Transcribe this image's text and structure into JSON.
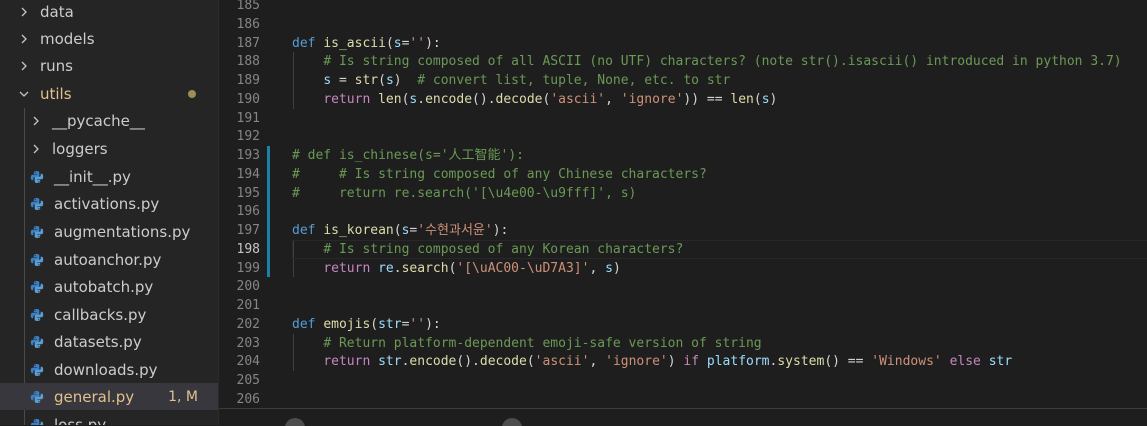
{
  "explorer": {
    "items": [
      {
        "label": "data",
        "kind": "folder",
        "expanded": false
      },
      {
        "label": "models",
        "kind": "folder",
        "expanded": false
      },
      {
        "label": "runs",
        "kind": "folder",
        "expanded": false
      },
      {
        "label": "utils",
        "kind": "folder",
        "expanded": true,
        "modified": true
      },
      {
        "label": "__pycache__",
        "kind": "folder",
        "expanded": false
      },
      {
        "label": "loggers",
        "kind": "folder",
        "expanded": false
      },
      {
        "label": "__init__.py",
        "kind": "file"
      },
      {
        "label": "activations.py",
        "kind": "file"
      },
      {
        "label": "augmentations.py",
        "kind": "file"
      },
      {
        "label": "autoanchor.py",
        "kind": "file"
      },
      {
        "label": "autobatch.py",
        "kind": "file"
      },
      {
        "label": "callbacks.py",
        "kind": "file"
      },
      {
        "label": "datasets.py",
        "kind": "file"
      },
      {
        "label": "downloads.py",
        "kind": "file"
      },
      {
        "label": "general.py",
        "kind": "file",
        "active": true,
        "badge": "1, M"
      },
      {
        "label": "loss.py",
        "kind": "file"
      }
    ]
  },
  "editor": {
    "current_line": "198",
    "lines": [
      {
        "n": "185",
        "tokens": []
      },
      {
        "n": "186",
        "tokens": []
      },
      {
        "n": "187",
        "tokens": [
          {
            "t": "def ",
            "c": "kw"
          },
          {
            "t": "is_ascii",
            "c": "fn"
          },
          {
            "t": "(",
            "c": "op"
          },
          {
            "t": "s",
            "c": "vr"
          },
          {
            "t": "=",
            "c": "op"
          },
          {
            "t": "''",
            "c": "str"
          },
          {
            "t": "):",
            "c": "op"
          }
        ]
      },
      {
        "n": "188",
        "tokens": [
          {
            "t": "    ",
            "c": "op"
          },
          {
            "t": "# Is string composed of all ASCII (no UTF) characters? (note str().isascii() introduced in python 3.7)",
            "c": "cm"
          }
        ]
      },
      {
        "n": "189",
        "tokens": [
          {
            "t": "    ",
            "c": "op"
          },
          {
            "t": "s",
            "c": "vr"
          },
          {
            "t": " = ",
            "c": "op"
          },
          {
            "t": "str",
            "c": "fn"
          },
          {
            "t": "(",
            "c": "op"
          },
          {
            "t": "s",
            "c": "vr"
          },
          {
            "t": ")  ",
            "c": "op"
          },
          {
            "t": "# convert list, tuple, None, etc. to str",
            "c": "cm"
          }
        ]
      },
      {
        "n": "190",
        "tokens": [
          {
            "t": "    ",
            "c": "op"
          },
          {
            "t": "return ",
            "c": "ctl"
          },
          {
            "t": "len",
            "c": "fn"
          },
          {
            "t": "(",
            "c": "op"
          },
          {
            "t": "s",
            "c": "vr"
          },
          {
            "t": ".",
            "c": "op"
          },
          {
            "t": "encode",
            "c": "fn"
          },
          {
            "t": "().",
            "c": "op"
          },
          {
            "t": "decode",
            "c": "fn"
          },
          {
            "t": "(",
            "c": "op"
          },
          {
            "t": "'ascii'",
            "c": "str"
          },
          {
            "t": ", ",
            "c": "op"
          },
          {
            "t": "'ignore'",
            "c": "str"
          },
          {
            "t": ")) == ",
            "c": "op"
          },
          {
            "t": "len",
            "c": "fn"
          },
          {
            "t": "(",
            "c": "op"
          },
          {
            "t": "s",
            "c": "vr"
          },
          {
            "t": ")",
            "c": "op"
          }
        ]
      },
      {
        "n": "191",
        "tokens": []
      },
      {
        "n": "192",
        "tokens": []
      },
      {
        "n": "193",
        "tokens": [
          {
            "t": "# def is_chinese(s='人工智能'):",
            "c": "cm"
          }
        ]
      },
      {
        "n": "194",
        "tokens": [
          {
            "t": "#     # Is string composed of any Chinese characters?",
            "c": "cm"
          }
        ]
      },
      {
        "n": "195",
        "tokens": [
          {
            "t": "#     return re.search('[\\u4e00-\\u9fff]', s)",
            "c": "cm"
          }
        ]
      },
      {
        "n": "196",
        "tokens": []
      },
      {
        "n": "197",
        "tokens": [
          {
            "t": "def ",
            "c": "kw"
          },
          {
            "t": "is_korean",
            "c": "fn"
          },
          {
            "t": "(",
            "c": "op"
          },
          {
            "t": "s",
            "c": "vr"
          },
          {
            "t": "=",
            "c": "op"
          },
          {
            "t": "'수현과서윤'",
            "c": "str"
          },
          {
            "t": "):",
            "c": "op"
          }
        ]
      },
      {
        "n": "198",
        "tokens": [
          {
            "t": "    ",
            "c": "op"
          },
          {
            "t": "# Is string composed of any Korean characters?",
            "c": "cm"
          }
        ]
      },
      {
        "n": "199",
        "tokens": [
          {
            "t": "    ",
            "c": "op"
          },
          {
            "t": "return ",
            "c": "ctl"
          },
          {
            "t": "re",
            "c": "vr"
          },
          {
            "t": ".",
            "c": "op"
          },
          {
            "t": "search",
            "c": "fn"
          },
          {
            "t": "(",
            "c": "op"
          },
          {
            "t": "'[\\uAC00-\\uD7A3]'",
            "c": "str"
          },
          {
            "t": ", ",
            "c": "op"
          },
          {
            "t": "s",
            "c": "vr"
          },
          {
            "t": ")",
            "c": "op"
          }
        ]
      },
      {
        "n": "200",
        "tokens": []
      },
      {
        "n": "201",
        "tokens": []
      },
      {
        "n": "202",
        "tokens": [
          {
            "t": "def ",
            "c": "kw"
          },
          {
            "t": "emojis",
            "c": "fn"
          },
          {
            "t": "(",
            "c": "op"
          },
          {
            "t": "str",
            "c": "vr"
          },
          {
            "t": "=",
            "c": "op"
          },
          {
            "t": "''",
            "c": "str"
          },
          {
            "t": "):",
            "c": "op"
          }
        ]
      },
      {
        "n": "203",
        "tokens": [
          {
            "t": "    ",
            "c": "op"
          },
          {
            "t": "# Return platform-dependent emoji-safe version of string",
            "c": "cm"
          }
        ]
      },
      {
        "n": "204",
        "tokens": [
          {
            "t": "    ",
            "c": "op"
          },
          {
            "t": "return ",
            "c": "ctl"
          },
          {
            "t": "str",
            "c": "vr"
          },
          {
            "t": ".",
            "c": "op"
          },
          {
            "t": "encode",
            "c": "fn"
          },
          {
            "t": "().",
            "c": "op"
          },
          {
            "t": "decode",
            "c": "fn"
          },
          {
            "t": "(",
            "c": "op"
          },
          {
            "t": "'ascii'",
            "c": "str"
          },
          {
            "t": ", ",
            "c": "op"
          },
          {
            "t": "'ignore'",
            "c": "str"
          },
          {
            "t": ") ",
            "c": "op"
          },
          {
            "t": "if ",
            "c": "ctl"
          },
          {
            "t": "platform",
            "c": "vr"
          },
          {
            "t": ".",
            "c": "op"
          },
          {
            "t": "system",
            "c": "fn"
          },
          {
            "t": "() == ",
            "c": "op"
          },
          {
            "t": "'Windows'",
            "c": "str"
          },
          {
            "t": " ",
            "c": "op"
          },
          {
            "t": "else ",
            "c": "ctl"
          },
          {
            "t": "str",
            "c": "vr"
          }
        ]
      },
      {
        "n": "205",
        "tokens": []
      },
      {
        "n": "206",
        "tokens": []
      }
    ]
  },
  "colors": {
    "sidebar_bg": "#252526",
    "editor_bg": "#1e1e1e",
    "modified": "#e2c08d",
    "gutter_modified": "#1b81a8",
    "python_icon": "#3b7fc4"
  }
}
